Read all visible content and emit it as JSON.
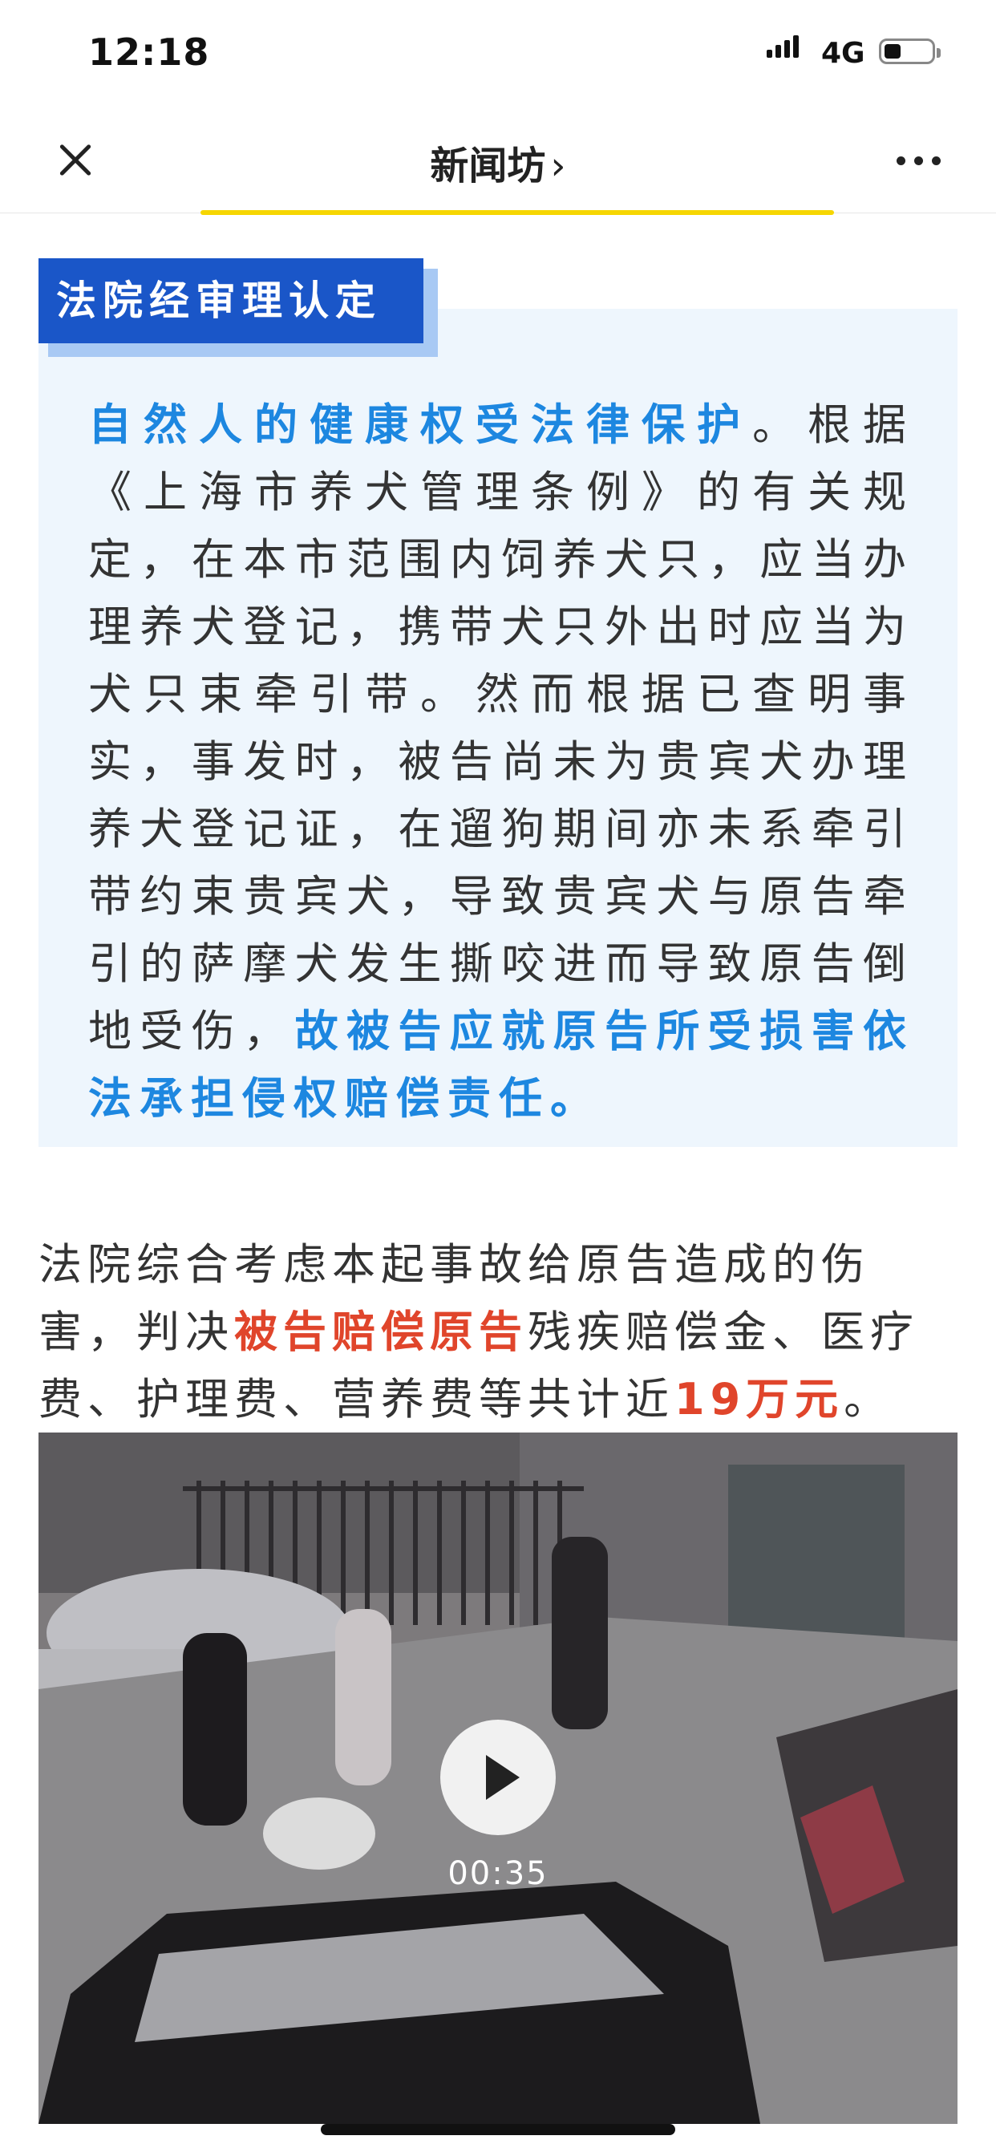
{
  "status_bar": {
    "time": "12:18",
    "network": "4G",
    "battery_level": 0.3
  },
  "nav": {
    "title": "新闻坊",
    "chevron": "›",
    "close_icon": "close-icon",
    "more_icon": "more-icon"
  },
  "section": {
    "label": "法院经审理认定",
    "para_highlight_1": "自然人的健康权受法律保护",
    "para_body": "。根据《上海市养犬管理条例》的有关规定，在本市范围内饲养犬只，应当办理养犬登记，携带犬只外出时应当为犬只束牵引带。然而根据已查明事实，事发时，被告尚未为贵宾犬办理养犬登记证，在遛狗期间亦未系牵引带约束贵宾犬，导致贵宾犬与原告牵引的萨摩犬发生撕咬进而导致原告倒地受伤，",
    "para_highlight_2": "故被告应就原告所受损害依法承担侵权赔偿责任。"
  },
  "judgment": {
    "part1": "法院综合考虑本起事故给原告造成的伤害，判决",
    "highlight1": "被告赔偿原告",
    "part2": "残疾赔偿金、医疗费、护理费、营养费等共计近",
    "highlight2": "19万元",
    "part3": "。"
  },
  "video": {
    "duration": "00:35",
    "play_icon": "play-icon"
  },
  "colors": {
    "accent_blue": "#1d87e0",
    "label_blue": "#1a56c8",
    "highlight_red": "#e0452b",
    "box_bg": "#eef6fd",
    "underline_yellow": "#f6d600"
  }
}
